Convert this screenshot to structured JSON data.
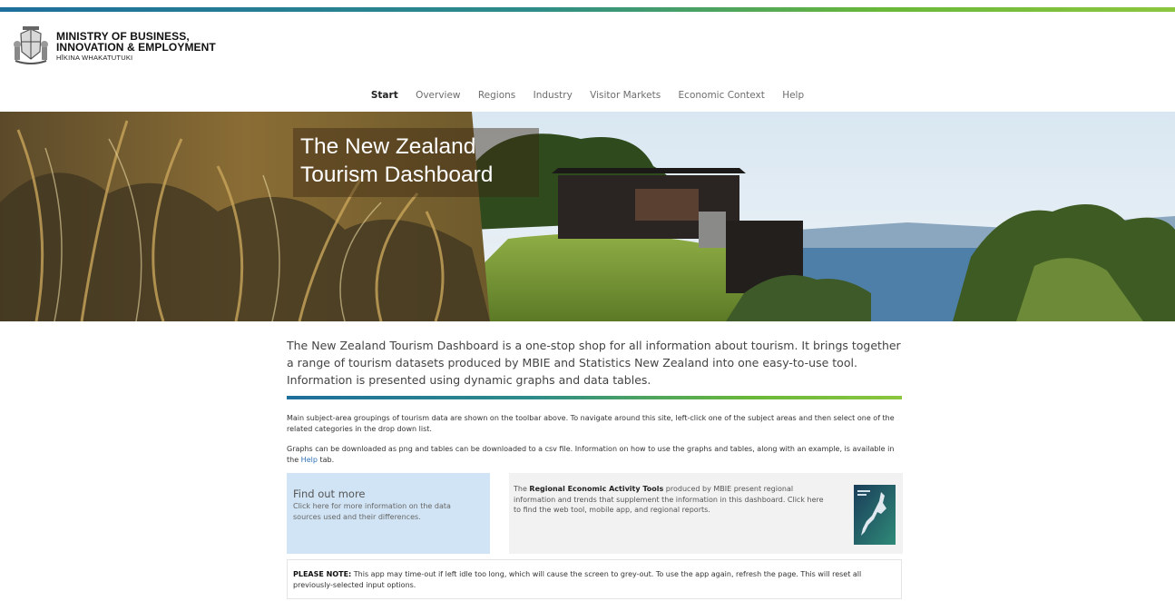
{
  "header": {
    "logo_line1": "MINISTRY OF BUSINESS,",
    "logo_line2": "INNOVATION & EMPLOYMENT",
    "logo_line3": "HĪKINA WHAKATUTUKI"
  },
  "nav": {
    "items": [
      {
        "label": "Start",
        "active": true
      },
      {
        "label": "Overview"
      },
      {
        "label": "Regions"
      },
      {
        "label": "Industry"
      },
      {
        "label": "Visitor Markets"
      },
      {
        "label": "Economic Context"
      },
      {
        "label": "Help"
      }
    ]
  },
  "hero": {
    "title_line1": "The New Zealand",
    "title_line2": "Tourism Dashboard"
  },
  "main": {
    "intro": "The New Zealand Tourism Dashboard is a one-stop shop for all information about tourism. It brings together a range of tourism datasets produced by MBIE and Statistics New Zealand into one easy-to-use tool. Information is presented using dynamic graphs and data tables.",
    "para1": "Main subject-area groupings of tourism data are shown on the toolbar above. To navigate around this site, left-click one of the subject areas and then select one of the related categories in the drop down list.",
    "para2_before": "Graphs can be downloaded as png and tables can be downloaded to a csv file. Information on how to use the graphs and tables, along with an example, is available in the ",
    "para2_link": "Help",
    "para2_after": " tab."
  },
  "findout": {
    "title": "Find out more",
    "text": "Click here for more information on the data sources used and their differences."
  },
  "reat": {
    "text_before": "The ",
    "bold": "Regional Economic Activity Tools",
    "text_after": " produced by MBIE present regional information and trends that supplement the information in this dashboard. Click here to find the web tool, mobile app, and regional reports."
  },
  "note": {
    "label": "PLEASE NOTE:",
    "text": " This app may time-out if left idle too long, which will cause the screen to grey-out. To use the app again, refresh the page. This will reset all previously-selected input options."
  },
  "colors": {
    "accent_blue": "#1e6f9c",
    "accent_green": "#8cc63f",
    "link": "#2f73b6",
    "findout_bg": "#d1e4f5",
    "reat_bg": "#f2f2f2"
  }
}
